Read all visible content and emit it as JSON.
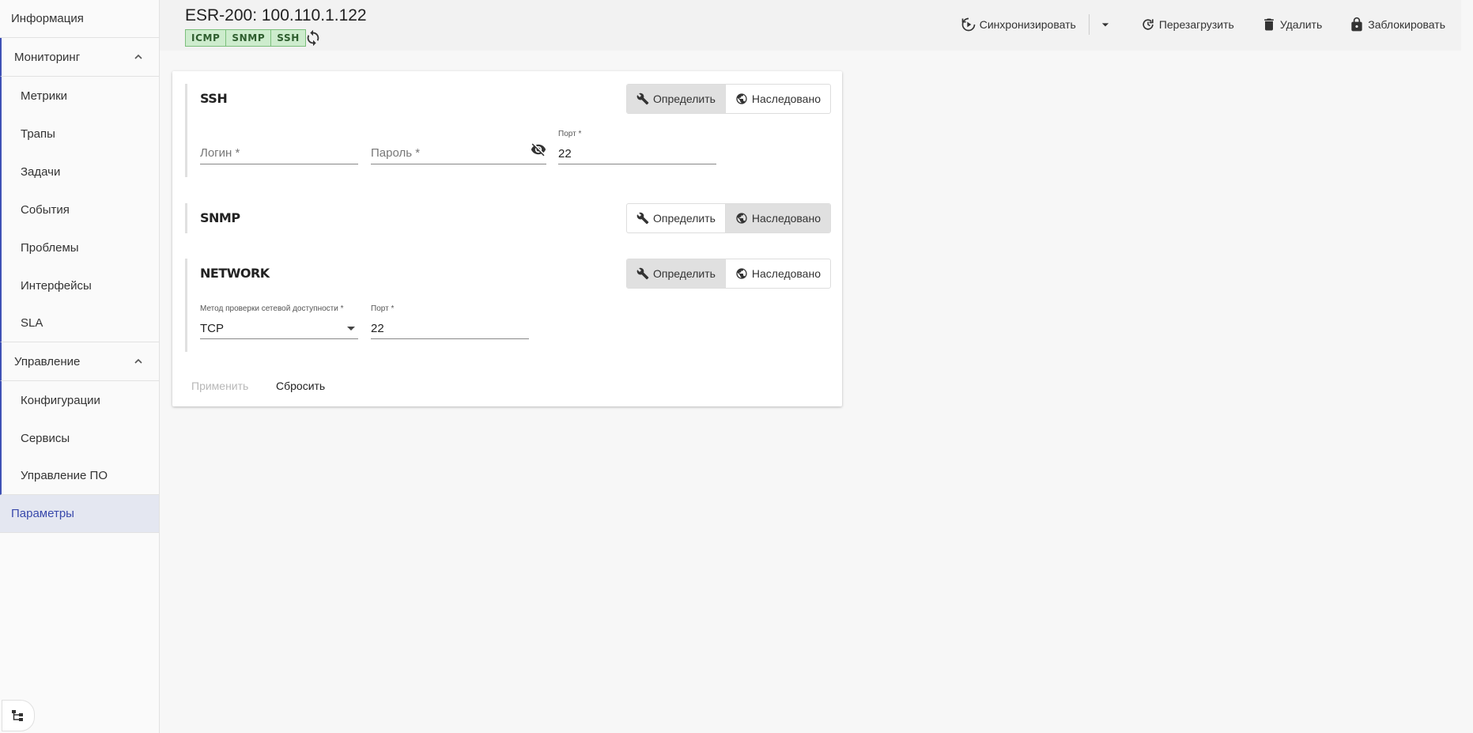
{
  "sidebar": {
    "info": "Информация",
    "monitoring": {
      "label": "Мониторинг",
      "items": [
        "Метрики",
        "Трапы",
        "Задачи",
        "События",
        "Проблемы",
        "Интерфейсы",
        "SLA"
      ]
    },
    "management": {
      "label": "Управление",
      "items": [
        "Конфигурации",
        "Сервисы",
        "Управление ПО"
      ]
    },
    "params": "Параметры",
    "accent_color": "#3f51b5"
  },
  "header": {
    "title": "ESR-200: 100.110.1.122",
    "chips": [
      "ICMP",
      "SNMP",
      "SSH"
    ],
    "chip_color": "#cdeccd",
    "actions": {
      "sync": "Синхронизировать",
      "reboot": "Перезагрузить",
      "delete": "Удалить",
      "lock": "Заблокировать"
    }
  },
  "sections": {
    "ssh": {
      "title": "SSH",
      "define": "Определить",
      "inherited": "Наследовано",
      "mode": "define",
      "login_placeholder": "Логин *",
      "password_placeholder": "Пароль *",
      "port_label": "Порт *",
      "port_value": "22"
    },
    "snmp": {
      "title": "SNMP",
      "define": "Определить",
      "inherited": "Наследовано",
      "mode": "inherited"
    },
    "network": {
      "title": "NETWORK",
      "define": "Определить",
      "inherited": "Наследовано",
      "mode": "define",
      "method_label": "Метод проверки сетевой доступности *",
      "method_value": "TCP",
      "port_label": "Порт *",
      "port_value": "22"
    }
  },
  "buttons": {
    "apply": "Применить",
    "reset": "Сбросить"
  }
}
